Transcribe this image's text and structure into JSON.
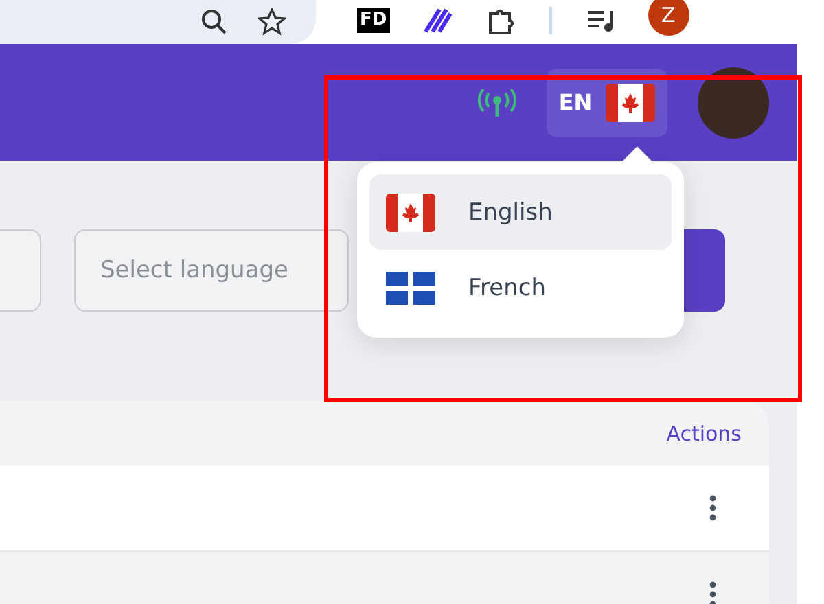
{
  "browser_toolbar": {
    "extension_label": "FD",
    "profile_initial": "Z"
  },
  "header": {
    "language_button": {
      "code": "EN",
      "kind": "canada"
    },
    "language_menu": {
      "items": [
        {
          "label": "English",
          "kind": "canada",
          "selected": true
        },
        {
          "label": "French",
          "kind": "quebec",
          "selected": false
        }
      ]
    }
  },
  "filters": {
    "language_select": {
      "placeholder": "Select language"
    }
  },
  "table": {
    "columns": [
      {
        "label": "Actions"
      }
    ]
  }
}
